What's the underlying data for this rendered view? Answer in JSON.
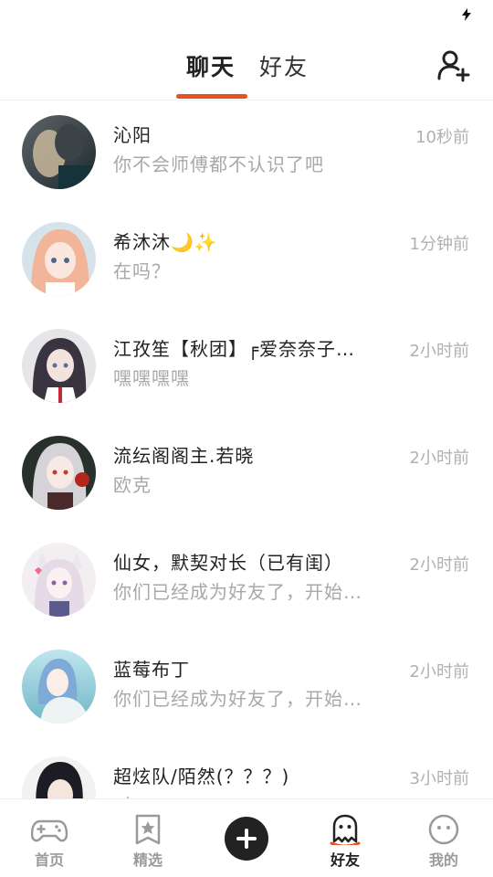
{
  "header": {
    "tabs": [
      {
        "label": "聊天",
        "active": true
      },
      {
        "label": "好友",
        "active": false
      }
    ],
    "add_friend_icon": "add-user-icon",
    "accent": "#e8501f"
  },
  "conversations": [
    {
      "name": "沁阳",
      "message": "你不会师傅都不认识了吧",
      "time": "10秒前"
    },
    {
      "name": "希沐沐🌙✨",
      "message": "在吗？",
      "time": "1分钟前"
    },
    {
      "name": "江孜笙【秋团】╒爱奈奈子…",
      "message": "嘿嘿嘿嘿",
      "time": "2小时前"
    },
    {
      "name": "流纭阁阁主.若晓",
      "message": "欧克",
      "time": "2小时前"
    },
    {
      "name": "仙女，默契对长（已有闺）",
      "message": "你们已经成为好友了，开始…",
      "time": "2小时前"
    },
    {
      "name": "蓝莓布丁",
      "message": "你们已经成为好友了，开始…",
      "time": "2小时前"
    },
    {
      "name": "超炫队/陌然(？？？)",
      "message": "对",
      "time": "3小时前"
    }
  ],
  "bottom_nav": {
    "items": [
      {
        "label": "首页",
        "icon": "gamepad-icon",
        "active": false
      },
      {
        "label": "精选",
        "icon": "star-bookmark-icon",
        "active": false
      },
      {
        "label": "",
        "icon": "plus-icon",
        "active": false
      },
      {
        "label": "好友",
        "icon": "ghost-icon",
        "active": true
      },
      {
        "label": "我的",
        "icon": "face-icon",
        "active": false
      }
    ]
  }
}
